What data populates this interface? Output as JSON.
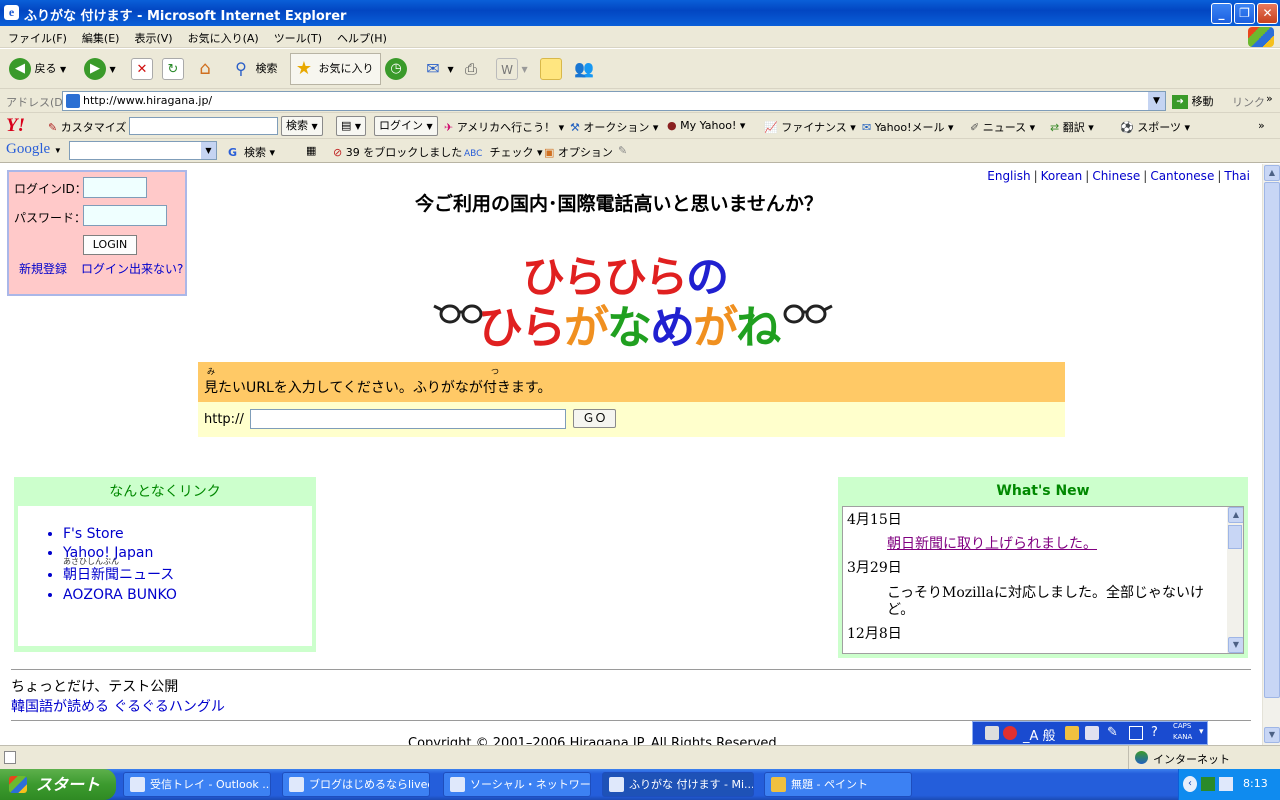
{
  "window": {
    "title": "ふりがな 付けます - Microsoft Internet Explorer",
    "controls": [
      "_",
      "❐",
      "✕"
    ]
  },
  "menu": [
    "ファイル(F)",
    "編集(E)",
    "表示(V)",
    "お気に入り(A)",
    "ツール(T)",
    "ヘルプ(H)"
  ],
  "toolbar": {
    "back": "戻る",
    "search": "検索",
    "favorites": "お気に入り"
  },
  "address": {
    "label": "アドレス(D)",
    "url": "http://www.hiragana.jp/",
    "go": "移動",
    "links": "リンク"
  },
  "yahoo_toolbar": {
    "logo": "Y!",
    "customize": "カスタマイズ",
    "search": "検索",
    "login": "ログイン",
    "items": [
      "アメリカへ行こう！",
      "オークション",
      "My Yahoo!",
      "ファイナンス",
      "Yahoo!メール",
      "ニュース",
      "翻訳",
      "スポーツ"
    ]
  },
  "google_toolbar": {
    "logo": "Google",
    "search": "検索",
    "blocked": "39 をブロックしました",
    "check": "チェック",
    "options": "オプション"
  },
  "login": {
    "id_label": "ログインID：",
    "password_label": "パスワード：",
    "button": "LOGIN",
    "register": "新規登録",
    "cant_login": "ログイン出来ない?"
  },
  "languages": [
    "English",
    "Korean",
    "Chinese",
    "Cantonese",
    "Thai"
  ],
  "headline": "今ご利用の国内･国際電話高いと思いませんか？",
  "logo": {
    "line1": [
      "ひ",
      "ら",
      "ひ",
      "ら",
      "の"
    ],
    "line2": [
      "ひ",
      "ら",
      "が",
      "な",
      "め",
      "が",
      "ね"
    ],
    "colors1": [
      "#e02020",
      "#e02020",
      "#e02020",
      "#e02020",
      "#2020d0"
    ],
    "colors2": [
      "#e02020",
      "#e02020",
      "#f09020",
      "#20a020",
      "#2020d0",
      "#f09020",
      "#20a020"
    ]
  },
  "url_prompt": {
    "message": "見たいURLを入力してください。ふりがなが付きます。",
    "ruby_mi": "み",
    "ruby_tsu": "つ",
    "prefix": "http://",
    "go": "ＧＯ"
  },
  "links_box": {
    "title": "なんとなくリンク",
    "items": [
      "F's Store",
      "Yahoo! Japan",
      "朝日新聞ニュース",
      "AOZORA BUNKO"
    ],
    "ruby": "あさひしんぶん"
  },
  "news_box": {
    "title": "What's New",
    "date1": "4月15日",
    "entry1": "朝日新聞に取り上げられました。",
    "date2": "3月29日",
    "entry2": "こっそりMozillaに対応しました。全部じゃないけど。",
    "date3": "12月8日"
  },
  "bottom": {
    "line1": "ちょっとだけ、テスト公開",
    "line2": "韓国語が読める ぐるぐるハングル",
    "copyright": "Copyright © 2001–2006 Hiragana.JP. All Rights Reserved."
  },
  "ime": {
    "mode": "_A 般",
    "caps": "CAPS",
    "kana": "KANA"
  },
  "status": {
    "zone": "インターネット"
  },
  "taskbar": {
    "start": "スタート",
    "tasks": [
      "受信トレイ - Outlook ...",
      "ブログはじめるならlived...",
      "ソーシャル・ネットワーキ...",
      "ふりがな 付けます - Mi...",
      "無題 - ペイント"
    ],
    "clock": "8:13"
  }
}
